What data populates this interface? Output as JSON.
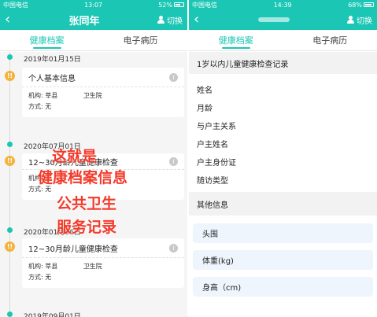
{
  "left": {
    "status": {
      "carrier": "中国电信",
      "time": "13:07",
      "battery": "52%"
    },
    "nav": {
      "title": "张同年",
      "switch_label": "切换"
    },
    "tabs": [
      "健康档案",
      "电子病历"
    ],
    "active_tab": 0,
    "entries": [
      {
        "date": "2019年01月15日",
        "title": "个人基本信息",
        "org_label": "机构:",
        "org_value": "莘县",
        "org_suffix": "卫生院",
        "mode_label": "方式:",
        "mode_value": "无"
      },
      {
        "date": "2020年07月01日",
        "title": "12~30月龄儿童健康检查",
        "org_label": "机构:",
        "org_value": "",
        "org_suffix": "",
        "mode_label": "方式:",
        "mode_value": "无"
      },
      {
        "date": "2020年01月06日",
        "title": "12~30月龄儿童健康检查",
        "org_label": "机构:",
        "org_value": "莘县",
        "org_suffix": "卫生院",
        "mode_label": "方式:",
        "mode_value": "无"
      },
      {
        "date": "2019年09月01日"
      }
    ],
    "badge_text": "!!",
    "overlay": [
      "这就是",
      "健康档案信息",
      "公共卫生",
      "服务记录"
    ],
    "colors": {
      "accent": "#1bc6b4",
      "badge": "#f3b33d",
      "overlay": "#f23a2a"
    }
  },
  "right": {
    "status": {
      "carrier": "中国电信",
      "time": "14:39",
      "battery": "68%"
    },
    "nav": {
      "switch_label": "切换"
    },
    "tabs": [
      "健康档案",
      "电子病历"
    ],
    "active_tab": 0,
    "section_title": "1岁以内儿童健康检查记录",
    "fields": [
      "姓名",
      "月龄",
      "与户主关系",
      "户主姓名",
      "户主身份证",
      "随访类型"
    ],
    "other_title": "其他信息",
    "boxes": [
      "头围",
      "体重(kg)",
      "身高（cm)"
    ]
  }
}
